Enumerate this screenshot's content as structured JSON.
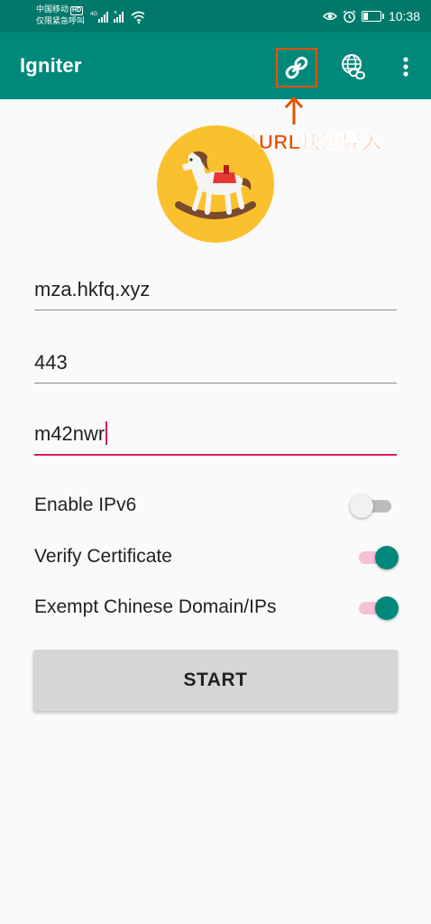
{
  "status_bar": {
    "carrier_line1": "中国移动",
    "carrier_hd": "HD",
    "carrier_line2": "仅限紧急呼叫",
    "network_type": "4G",
    "time": "10:38",
    "icons": [
      "eye-comfort-icon",
      "alarm-icon",
      "battery-icon",
      "wifi-icon",
      "signal-icon"
    ]
  },
  "app_bar": {
    "title": "Igniter",
    "actions": [
      "link-icon",
      "globe-link-icon",
      "more-vert-icon"
    ]
  },
  "annotation": {
    "text": "通过URL快速导入",
    "color": "#e65100"
  },
  "form": {
    "server": "mza.hkfq.xyz",
    "port": "443",
    "password": "m42nwr"
  },
  "options": [
    {
      "label": "Enable IPv6",
      "enabled": false
    },
    {
      "label": "Verify Certificate",
      "enabled": true
    },
    {
      "label": "Exempt Chinese Domain/IPs",
      "enabled": true
    }
  ],
  "start_label": "START",
  "colors": {
    "primary": "#00897b",
    "primary_dark": "#00796b",
    "accent": "#d81b60",
    "logo_bg": "#fbc02d"
  }
}
